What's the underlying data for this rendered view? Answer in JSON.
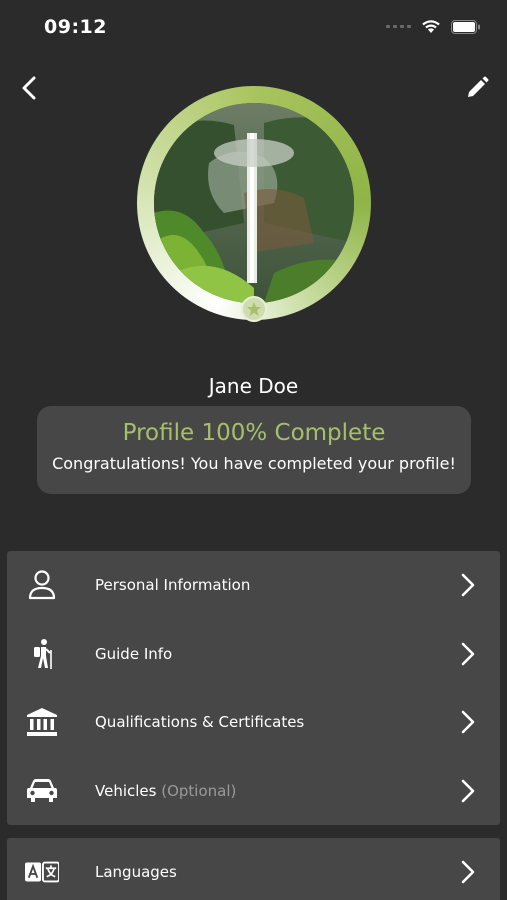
{
  "status_bar": {
    "time": "09:12"
  },
  "header": {
    "back_icon": "chevron-left-icon",
    "edit_icon": "pencil-icon"
  },
  "profile": {
    "name": "Jane Doe",
    "completion_percent": 100,
    "completion_title": "Profile 100% Complete",
    "completion_message": "Congratulations! You have completed your profile!",
    "accent_color": "#a8bf6a"
  },
  "menu": {
    "items": [
      {
        "label": "Personal Information",
        "icon": "person-icon"
      },
      {
        "label": "Guide Info",
        "icon": "hiker-icon"
      },
      {
        "label": "Qualifications & Certificates",
        "icon": "institution-icon"
      },
      {
        "label": "Vehicles",
        "suffix": "(Optional)",
        "icon": "car-icon"
      },
      {
        "label": "Languages",
        "icon": "translate-icon"
      }
    ]
  }
}
